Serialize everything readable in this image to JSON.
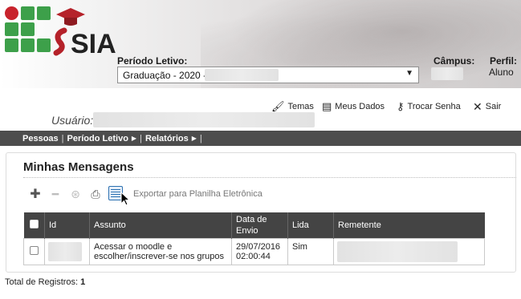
{
  "app": {
    "logo_text": "SIA"
  },
  "header": {
    "periodo_label": "Período Letivo:",
    "periodo_value": "Graduação - 2020 -",
    "campus_label": "Câmpus:",
    "perfil_label": "Perfil:",
    "perfil_value": "Aluno"
  },
  "user": {
    "label": "Usuário:"
  },
  "top_actions": [
    {
      "label": "Temas",
      "icon": "brush-icon"
    },
    {
      "label": "Meus Dados",
      "icon": "id-card-icon"
    },
    {
      "label": "Trocar Senha",
      "icon": "key-icon"
    },
    {
      "label": "Sair",
      "icon": "close-icon"
    }
  ],
  "nav": {
    "items": [
      {
        "label": "Pessoas"
      },
      {
        "label": "Período Letivo"
      },
      {
        "label": "Relatórios"
      }
    ]
  },
  "page": {
    "title": "Minhas Mensagens",
    "export_label": "Exportar para Planilha Eletrônica"
  },
  "table": {
    "headers": [
      "Id",
      "Assunto",
      "Data de Envio",
      "Lida",
      "Remetente"
    ],
    "rows": [
      {
        "id": "",
        "assunto": "Acessar o moodle e escolher/inscrever-se nos grupos",
        "data": "29/07/2016 02:00:44",
        "lida": "Sim",
        "remetente": ""
      }
    ]
  },
  "footer": {
    "total_label": "Total de Registros:",
    "total_value": "1"
  },
  "colors": {
    "nav_bg": "#4d4d4d",
    "table_header_bg": "#444444",
    "if_green": "#3da04a",
    "if_red": "#c8232c"
  }
}
